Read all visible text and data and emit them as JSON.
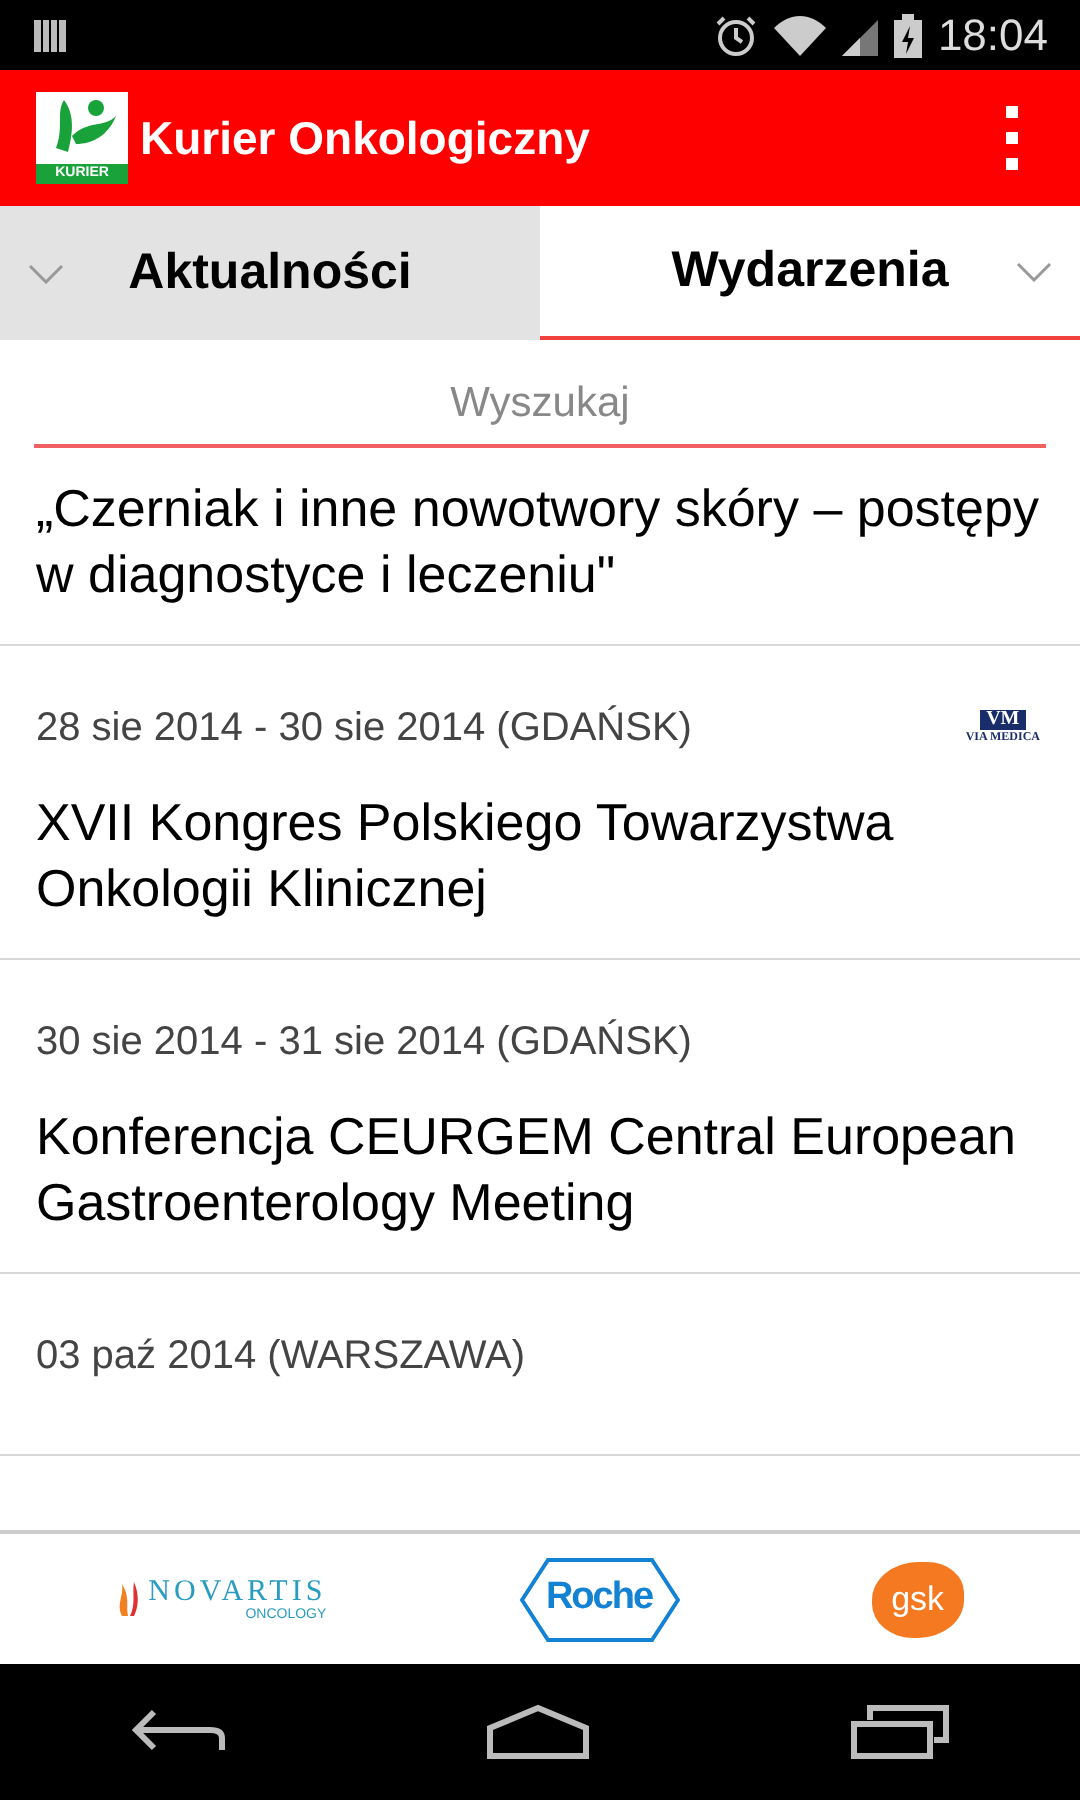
{
  "status_bar": {
    "time": "18:04"
  },
  "app_bar": {
    "logo_text": "KURIER",
    "title": "Kurier Onkologiczny"
  },
  "tabs": [
    {
      "label": "Aktualności",
      "selected": false
    },
    {
      "label": "Wydarzenia",
      "selected": true
    }
  ],
  "search": {
    "placeholder": "Wyszukaj"
  },
  "events": [
    {
      "title": "„Czerniak i inne nowotwory skóry – postępy w diagnostyce i leczeniu\""
    },
    {
      "date": "28 sie 2014 - 30 sie 2014 (GDAŃSK)",
      "title": "XVII Kongres Polskiego Towarzystwa Onkologii Klinicznej",
      "logo": {
        "mark": "VM",
        "text": "VIA MEDICA"
      }
    },
    {
      "date": "30 sie 2014 - 31 sie 2014 (GDAŃSK)",
      "title": "Konferencja CEURGEM Central European Gastroenterology Meeting"
    },
    {
      "date": "03 paź 2014 (WARSZAWA)"
    }
  ],
  "sponsors": [
    {
      "kind": "novartis",
      "name": "NOVARTIS",
      "sub": "ONCOLOGY"
    },
    {
      "kind": "roche",
      "name": "Roche"
    },
    {
      "kind": "gsk",
      "name": "gsk"
    }
  ]
}
